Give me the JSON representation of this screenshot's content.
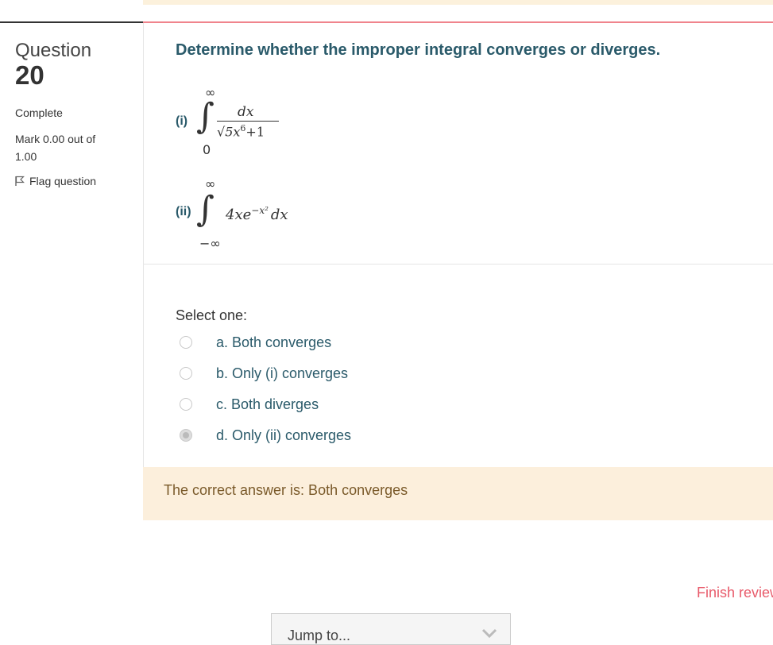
{
  "info": {
    "question_word": "Question",
    "question_number": "20",
    "state": "Complete",
    "mark": "Mark 0.00 out of 1.00",
    "flag_label": "Flag question"
  },
  "question": {
    "text": "Determine whether the improper integral converges or diverges.",
    "part1": {
      "label": "(i)",
      "upper": "∞",
      "lower": "0",
      "numerator": "dx",
      "denominator_base": "5x",
      "denominator_exp": "6",
      "denominator_tail": "+1"
    },
    "part2": {
      "label": "(ii)",
      "upper": "∞",
      "lower": "−∞",
      "integrand_base": "4xe",
      "integrand_exp": "−x²",
      "integrand_tail": "dx"
    }
  },
  "answer": {
    "prompt": "Select one:",
    "options": [
      {
        "label": "a. Both converges",
        "selected": false
      },
      {
        "label": "b. Only (i) converges",
        "selected": false
      },
      {
        "label": "c. Both diverges",
        "selected": false
      },
      {
        "label": "d. Only (ii) converges",
        "selected": true
      }
    ]
  },
  "feedback": "The correct answer is: Both converges",
  "nav": {
    "finish_review": "Finish review",
    "jump_placeholder": "Jump to..."
  },
  "colors": {
    "accent": "#2a5a6a",
    "feedback_bg": "#fcefdc",
    "link": "#e85a6a",
    "rule": "#f0848c"
  }
}
